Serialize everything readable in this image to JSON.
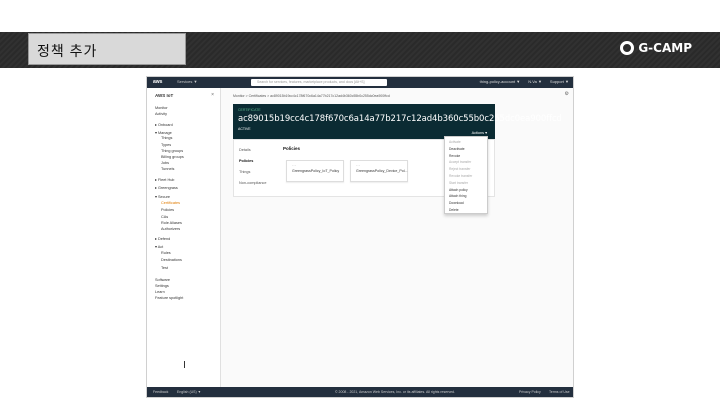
{
  "slide": {
    "title": "정책 추가",
    "brand": "G-CAMP"
  },
  "topbar": {
    "brand": "aws",
    "services": "Services ▼",
    "search_placeholder": "Search for services, features, marketplace products, and docs  [Alt+S]",
    "right_items": [
      "thing-policy-account ▼",
      "N.Va ▼",
      "Support ▼"
    ]
  },
  "sidebar": {
    "title": "AWS IoT",
    "items": [
      {
        "label": "Monitor",
        "active": false
      },
      {
        "label": "Activity",
        "active": false
      },
      {
        "label": "▸ Onboard",
        "active": false
      },
      {
        "label": "▾ Manage",
        "active": false
      },
      {
        "label": "Things",
        "active": false
      },
      {
        "label": "Types",
        "active": false
      },
      {
        "label": "Thing groups",
        "active": false
      },
      {
        "label": "Billing groups",
        "active": false
      },
      {
        "label": "Jobs",
        "active": false
      },
      {
        "label": "Tunnels",
        "active": false
      },
      {
        "label": "▸ Fleet Hub",
        "active": false
      },
      {
        "label": "▸ Greengrass",
        "active": false
      },
      {
        "label": "▾ Secure",
        "active": false
      },
      {
        "label": "Certificates",
        "active": true
      },
      {
        "label": "Policies",
        "active": false
      },
      {
        "label": "CAs",
        "active": false
      },
      {
        "label": "Role Aliases",
        "active": false
      },
      {
        "label": "Authorizers",
        "active": false
      },
      {
        "label": "▸ Defend",
        "active": false
      },
      {
        "label": "▾ Act",
        "active": false
      },
      {
        "label": "Rules",
        "active": false
      },
      {
        "label": "Destinations",
        "active": false
      },
      {
        "label": "Test",
        "active": false
      },
      {
        "label": "Software",
        "active": false
      },
      {
        "label": "Settings",
        "active": false
      },
      {
        "label": "Learn",
        "active": false
      },
      {
        "label": "Feature spotlight",
        "active": false
      }
    ]
  },
  "breadcrumb": "Monitor  >  Certificates  >  ac89015b19cc4c178f670c6a14a77b217c12ad4b360c55b0c255dc0ea900ffcd",
  "certificate": {
    "label": "CERTIFICATE",
    "id": "ac89015b19cc4c178f670c6a14a77b217c12ad4b360c55b0c255dc0ea900ffcd",
    "status": "ACTIVE",
    "actions_label": "Actions ▾"
  },
  "tabs": [
    {
      "label": "Details",
      "selected": false
    },
    {
      "label": "Policies",
      "selected": true
    },
    {
      "label": "Things",
      "selected": false
    },
    {
      "label": "Non-compliance",
      "selected": false
    }
  ],
  "policies": {
    "heading": "Policies",
    "cards": [
      "GreengrassPolicy_IoT_Policy",
      "GreengrassPolicy_Device_Pol..."
    ]
  },
  "actions_menu": [
    {
      "label": "Activate",
      "enabled": false
    },
    {
      "label": "Deactivate",
      "enabled": true
    },
    {
      "label": "Revoke",
      "enabled": true
    },
    {
      "label": "Accept transfer",
      "enabled": false
    },
    {
      "label": "Reject transfer",
      "enabled": false
    },
    {
      "label": "Revoke transfer",
      "enabled": false
    },
    {
      "label": "Start transfer",
      "enabled": false
    },
    {
      "label": "Attach policy",
      "enabled": true
    },
    {
      "label": "Attach thing",
      "enabled": true
    },
    {
      "label": "Download",
      "enabled": true
    },
    {
      "label": "Delete",
      "enabled": true
    }
  ],
  "footer": {
    "feedback": "Feedback",
    "language": "English (US) ▼",
    "copyright": "© 2008 - 2021, Amazon Web Services, Inc. or its affiliates. All rights reserved.",
    "privacy": "Privacy Policy",
    "terms": "Terms of Use"
  }
}
